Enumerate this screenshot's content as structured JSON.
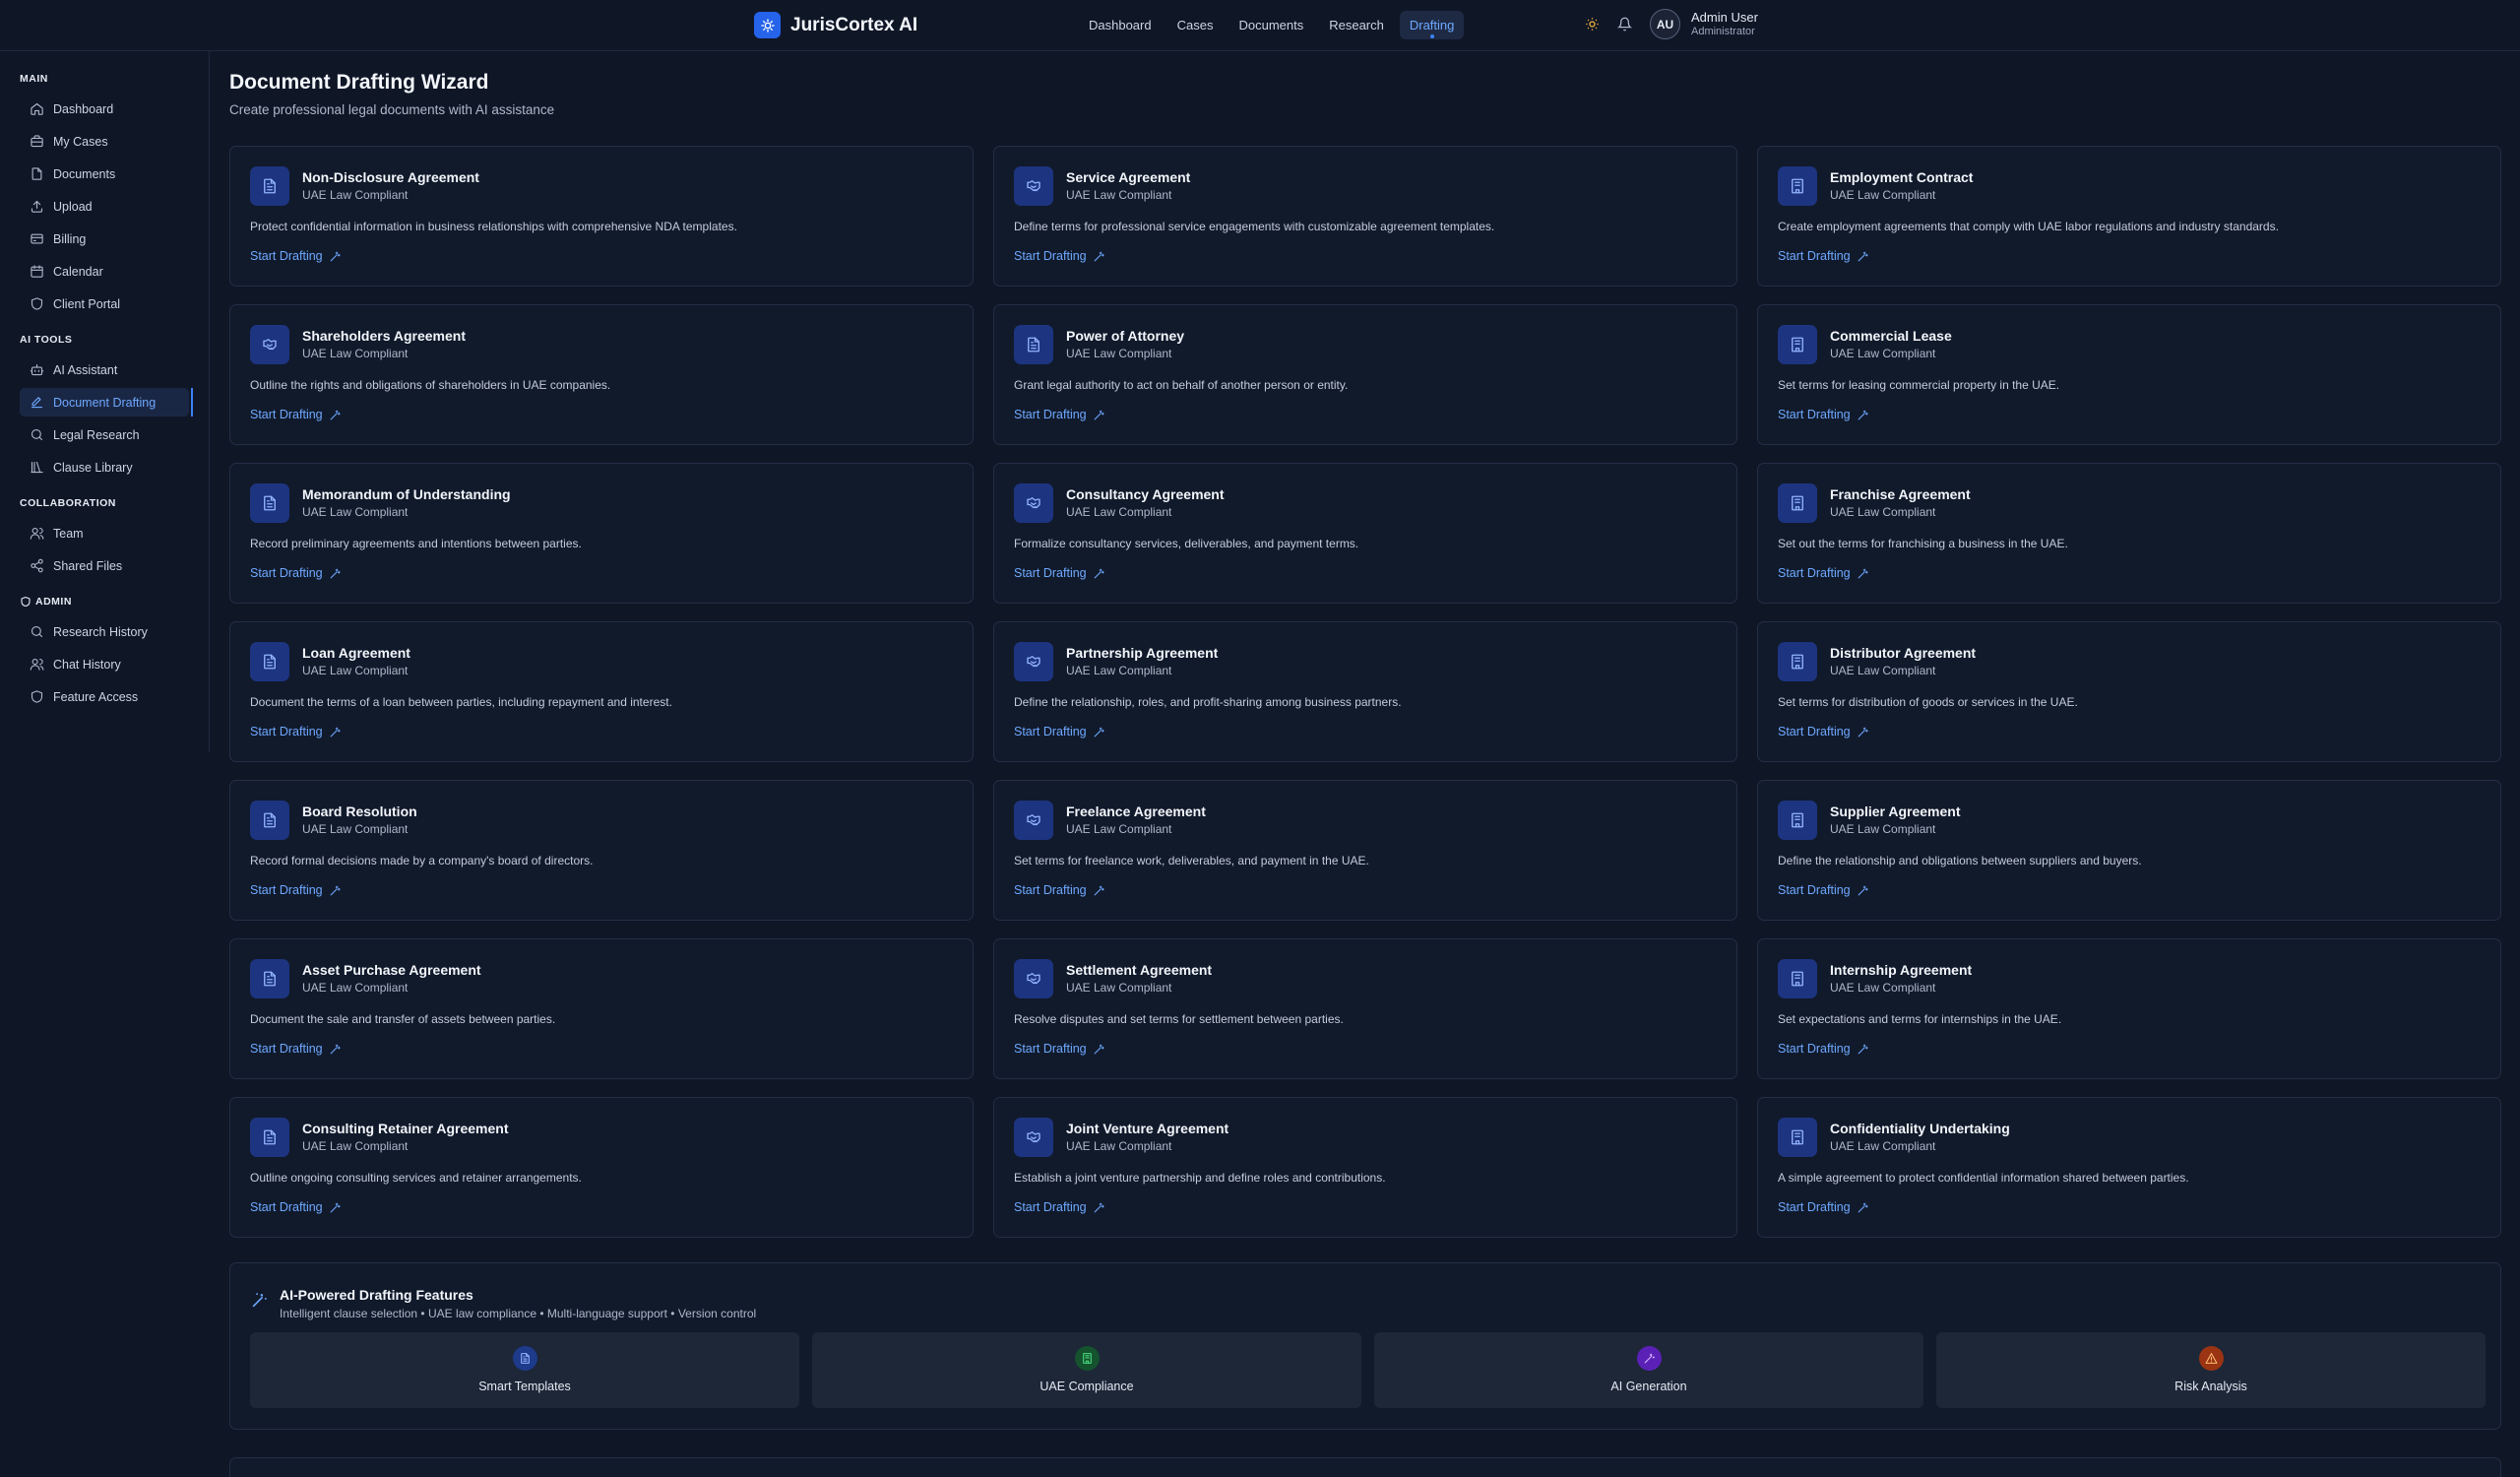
{
  "brand": {
    "name": "JurisCortex AI"
  },
  "topnav": [
    {
      "label": "Dashboard",
      "active": false
    },
    {
      "label": "Cases",
      "active": false
    },
    {
      "label": "Documents",
      "active": false
    },
    {
      "label": "Research",
      "active": false
    },
    {
      "label": "Drafting",
      "active": true
    }
  ],
  "user": {
    "initials": "AU",
    "name": "Admin User",
    "role": "Administrator"
  },
  "sidebar": {
    "sections": [
      {
        "heading": "MAIN",
        "items": [
          {
            "label": "Dashboard",
            "icon": "home-icon"
          },
          {
            "label": "My Cases",
            "icon": "briefcase-icon"
          },
          {
            "label": "Documents",
            "icon": "file-icon"
          },
          {
            "label": "Upload",
            "icon": "upload-icon"
          },
          {
            "label": "Billing",
            "icon": "credit-card-icon"
          },
          {
            "label": "Calendar",
            "icon": "calendar-icon"
          },
          {
            "label": "Client Portal",
            "icon": "shield-icon"
          }
        ]
      },
      {
        "heading": "AI TOOLS",
        "items": [
          {
            "label": "AI Assistant",
            "icon": "bot-icon"
          },
          {
            "label": "Document Drafting",
            "icon": "edit-icon",
            "active": true
          },
          {
            "label": "Legal Research",
            "icon": "search-icon"
          },
          {
            "label": "Clause Library",
            "icon": "library-icon"
          }
        ]
      },
      {
        "heading": "COLLABORATION",
        "items": [
          {
            "label": "Team",
            "icon": "users-icon"
          },
          {
            "label": "Shared Files",
            "icon": "share-icon"
          }
        ]
      },
      {
        "heading": "ADMIN",
        "headingIcon": "shield-icon",
        "items": [
          {
            "label": "Research History",
            "icon": "search-icon"
          },
          {
            "label": "Chat History",
            "icon": "users-icon"
          },
          {
            "label": "Feature Access",
            "icon": "shield-icon"
          }
        ]
      }
    ]
  },
  "page": {
    "title": "Document Drafting Wizard",
    "subtitle": "Create professional legal documents with AI assistance"
  },
  "cards": [
    {
      "title": "Non-Disclosure Agreement",
      "tag": "UAE Law Compliant",
      "icon": "file-text-icon",
      "desc": "Protect confidential information in business relationships with comprehensive NDA templates.",
      "action": "Start Drafting"
    },
    {
      "title": "Service Agreement",
      "tag": "UAE Law Compliant",
      "icon": "handshake-icon",
      "desc": "Define terms for professional service engagements with customizable agreement templates.",
      "action": "Start Drafting"
    },
    {
      "title": "Employment Contract",
      "tag": "UAE Law Compliant",
      "icon": "building-icon",
      "desc": "Create employment agreements that comply with UAE labor regulations and industry standards.",
      "action": "Start Drafting"
    },
    {
      "title": "Shareholders Agreement",
      "tag": "UAE Law Compliant",
      "icon": "handshake-icon",
      "desc": "Outline the rights and obligations of shareholders in UAE companies.",
      "action": "Start Drafting"
    },
    {
      "title": "Power of Attorney",
      "tag": "UAE Law Compliant",
      "icon": "file-text-icon",
      "desc": "Grant legal authority to act on behalf of another person or entity.",
      "action": "Start Drafting"
    },
    {
      "title": "Commercial Lease",
      "tag": "UAE Law Compliant",
      "icon": "building-icon",
      "desc": "Set terms for leasing commercial property in the UAE.",
      "action": "Start Drafting"
    },
    {
      "title": "Memorandum of Understanding",
      "tag": "UAE Law Compliant",
      "icon": "file-text-icon",
      "desc": "Record preliminary agreements and intentions between parties.",
      "action": "Start Drafting"
    },
    {
      "title": "Consultancy Agreement",
      "tag": "UAE Law Compliant",
      "icon": "handshake-icon",
      "desc": "Formalize consultancy services, deliverables, and payment terms.",
      "action": "Start Drafting"
    },
    {
      "title": "Franchise Agreement",
      "tag": "UAE Law Compliant",
      "icon": "building-icon",
      "desc": "Set out the terms for franchising a business in the UAE.",
      "action": "Start Drafting"
    },
    {
      "title": "Loan Agreement",
      "tag": "UAE Law Compliant",
      "icon": "file-text-icon",
      "desc": "Document the terms of a loan between parties, including repayment and interest.",
      "action": "Start Drafting"
    },
    {
      "title": "Partnership Agreement",
      "tag": "UAE Law Compliant",
      "icon": "handshake-icon",
      "desc": "Define the relationship, roles, and profit-sharing among business partners.",
      "action": "Start Drafting"
    },
    {
      "title": "Distributor Agreement",
      "tag": "UAE Law Compliant",
      "icon": "building-icon",
      "desc": "Set terms for distribution of goods or services in the UAE.",
      "action": "Start Drafting"
    },
    {
      "title": "Board Resolution",
      "tag": "UAE Law Compliant",
      "icon": "file-text-icon",
      "desc": "Record formal decisions made by a company's board of directors.",
      "action": "Start Drafting"
    },
    {
      "title": "Freelance Agreement",
      "tag": "UAE Law Compliant",
      "icon": "handshake-icon",
      "desc": "Set terms for freelance work, deliverables, and payment in the UAE.",
      "action": "Start Drafting"
    },
    {
      "title": "Supplier Agreement",
      "tag": "UAE Law Compliant",
      "icon": "building-icon",
      "desc": "Define the relationship and obligations between suppliers and buyers.",
      "action": "Start Drafting"
    },
    {
      "title": "Asset Purchase Agreement",
      "tag": "UAE Law Compliant",
      "icon": "file-text-icon",
      "desc": "Document the sale and transfer of assets between parties.",
      "action": "Start Drafting"
    },
    {
      "title": "Settlement Agreement",
      "tag": "UAE Law Compliant",
      "icon": "handshake-icon",
      "desc": "Resolve disputes and set terms for settlement between parties.",
      "action": "Start Drafting"
    },
    {
      "title": "Internship Agreement",
      "tag": "UAE Law Compliant",
      "icon": "building-icon",
      "desc": "Set expectations and terms for internships in the UAE.",
      "action": "Start Drafting"
    },
    {
      "title": "Consulting Retainer Agreement",
      "tag": "UAE Law Compliant",
      "icon": "file-text-icon",
      "desc": "Outline ongoing consulting services and retainer arrangements.",
      "action": "Start Drafting"
    },
    {
      "title": "Joint Venture Agreement",
      "tag": "UAE Law Compliant",
      "icon": "handshake-icon",
      "desc": "Establish a joint venture partnership and define roles and contributions.",
      "action": "Start Drafting"
    },
    {
      "title": "Confidentiality Undertaking",
      "tag": "UAE Law Compliant",
      "icon": "building-icon",
      "desc": "A simple agreement to protect confidential information shared between parties.",
      "action": "Start Drafting"
    }
  ],
  "features": {
    "title": "AI-Powered Drafting Features",
    "subtitle": "Intelligent clause selection • UAE law compliance • Multi-language support • Version control",
    "tiles": [
      {
        "label": "Smart Templates",
        "icon": "file-text-icon",
        "color": "#1e3a8a",
        "iconColor": "#93b4ff"
      },
      {
        "label": "UAE Compliance",
        "icon": "building-icon",
        "color": "#14532d",
        "iconColor": "#4ade80"
      },
      {
        "label": "AI Generation",
        "icon": "wand-icon",
        "color": "#5b21b6",
        "iconColor": "#d8b4fe"
      },
      {
        "label": "Risk Analysis",
        "icon": "warning-icon",
        "color": "#9a3412",
        "iconColor": "#fdba74"
      }
    ]
  },
  "colors": {
    "accent": "#3b82f6",
    "link": "#6ea8ff",
    "background": "#0f1626",
    "card": "#111a2b"
  }
}
